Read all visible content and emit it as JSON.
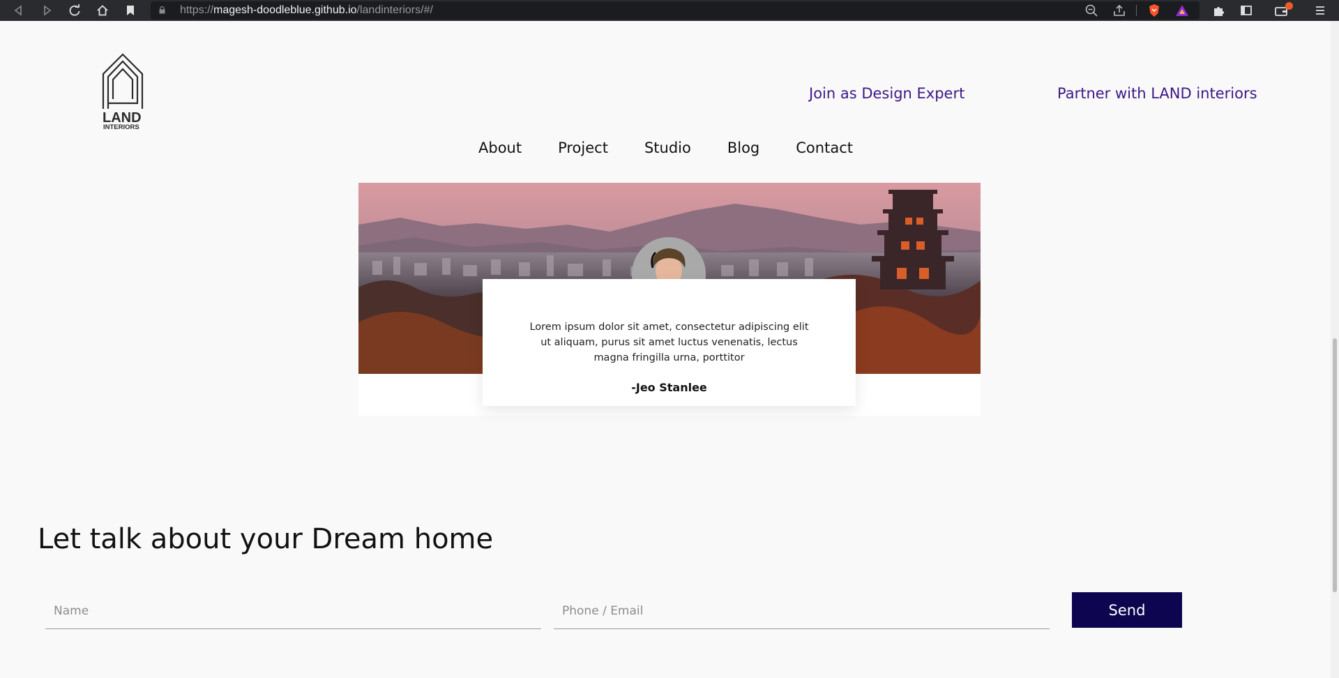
{
  "browser": {
    "url_scheme": "https://",
    "url_host": "magesh-doodleblue.github.io",
    "url_path": "/landinteriors/#/"
  },
  "header": {
    "logo_word": "LAND",
    "logo_sub": "INTERIORS",
    "join_link": "Join as Design Expert",
    "partner_link": "Partner with LAND interiors",
    "menu": [
      "About",
      "Project",
      "Studio",
      "Blog",
      "Contact"
    ]
  },
  "testimonial": {
    "quote": "Lorem ipsum dolor sit amet, consectetur adipiscing elit ut aliquam, purus sit amet luctus venenatis, lectus magna fringilla urna, porttitor",
    "author": "-Jeo Stanlee"
  },
  "contact": {
    "headline": "Let talk about your Dream home",
    "name_placeholder": "Name",
    "contact_placeholder": "Phone / Email",
    "send_label": "Send"
  },
  "colors": {
    "accent_link": "#3d1786",
    "send_button": "#0d0550",
    "page_bg": "#f9f9f9"
  }
}
